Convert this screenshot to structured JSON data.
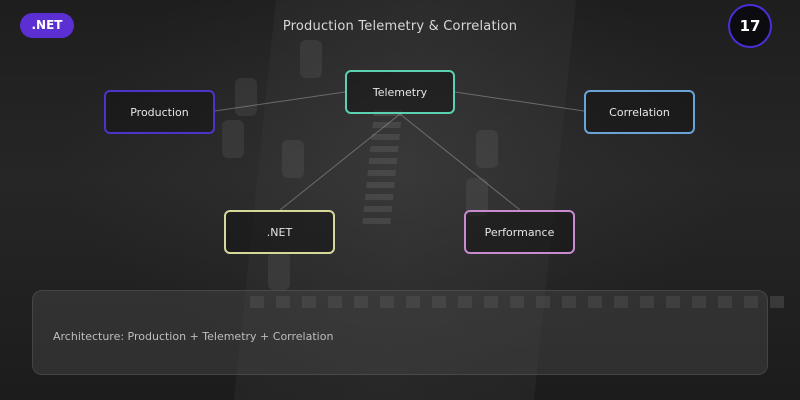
{
  "header": {
    "badge": ".NET",
    "title": "Production Telemetry & Correlation",
    "page_number": "17"
  },
  "diagram": {
    "nodes": {
      "production": "Production",
      "telemetry": "Telemetry",
      "correlation": "Correlation",
      "net": ".NET",
      "performance": "Performance"
    },
    "colors": {
      "production": "#4b35c8",
      "telemetry": "#5bd0b2",
      "correlation": "#6aa3d6",
      "net": "#d6d79b",
      "performance": "#c98ad0"
    }
  },
  "info_panel": {
    "text": "Architecture: Production + Telemetry + Correlation"
  },
  "theme": {
    "accent": "#5b2fd1",
    "page_ring": "#4a2fd8"
  }
}
